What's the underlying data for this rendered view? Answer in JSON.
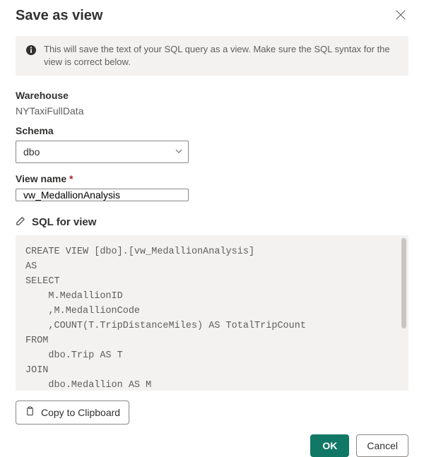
{
  "dialog": {
    "title": "Save as view",
    "info_text": "This will save the text of your SQL query as a view. Make sure the SQL syntax for the view is correct below."
  },
  "warehouse": {
    "label": "Warehouse",
    "value": "NYTaxiFullData"
  },
  "schema": {
    "label": "Schema",
    "selected": "dbo"
  },
  "view_name": {
    "label": "View name",
    "required_marker": "*",
    "value": "vw_MedallionAnalysis"
  },
  "sql": {
    "header": "SQL for view",
    "code": "CREATE VIEW [dbo].[vw_MedallionAnalysis]\nAS\nSELECT\n    M.MedallionID\n    ,M.MedallionCode\n    ,COUNT(T.TripDistanceMiles) AS TotalTripCount\nFROM\n    dbo.Trip AS T\nJOIN\n    dbo.Medallion AS M"
  },
  "buttons": {
    "copy": "Copy to Clipboard",
    "ok": "OK",
    "cancel": "Cancel"
  },
  "colors": {
    "primary": "#117865"
  }
}
